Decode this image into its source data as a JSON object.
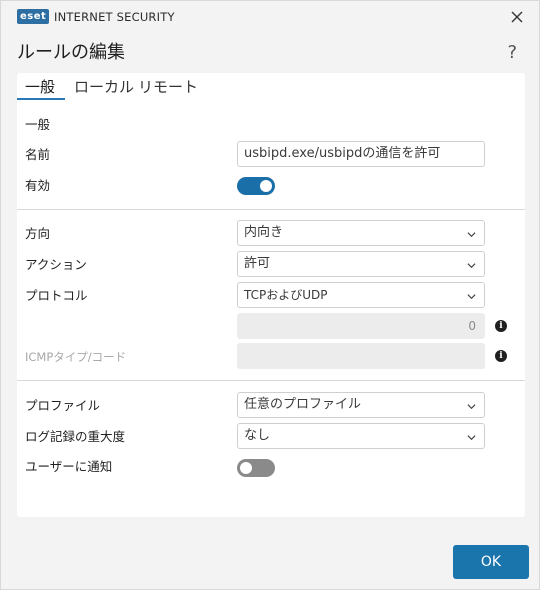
{
  "app": {
    "logo": "eset",
    "product": "INTERNET SECURITY"
  },
  "dialog": {
    "title": "ルールの編集",
    "help": "?"
  },
  "tabs": [
    {
      "label": "一般"
    },
    {
      "label": "ローカル"
    },
    {
      "label": "リモート"
    }
  ],
  "general": {
    "section_label": "一般",
    "name_label": "名前",
    "name_value": "usbipd.exe/usbipdの通信を許可",
    "enabled_label": "有効",
    "enabled": true
  },
  "connection": {
    "direction_label": "方向",
    "direction_value": "内向き",
    "action_label": "アクション",
    "action_value": "許可",
    "protocol_label": "プロトコル",
    "protocol_value": "TCPおよびUDP",
    "protocol_number": "0",
    "icmp_label": "ICMPタイプ/コード",
    "icmp_value": ""
  },
  "profile": {
    "profile_label": "プロファイル",
    "profile_value": "任意のプロファイル",
    "severity_label": "ログ記録の重大度",
    "severity_value": "なし",
    "notify_label": "ユーザーに通知",
    "notify": false
  },
  "footer": {
    "ok_label": "OK"
  },
  "colors": {
    "accent": "#1b75ad",
    "toggle_off": "#8a8a8a",
    "panel": "#ffffff",
    "background": "#f3f3f3"
  }
}
